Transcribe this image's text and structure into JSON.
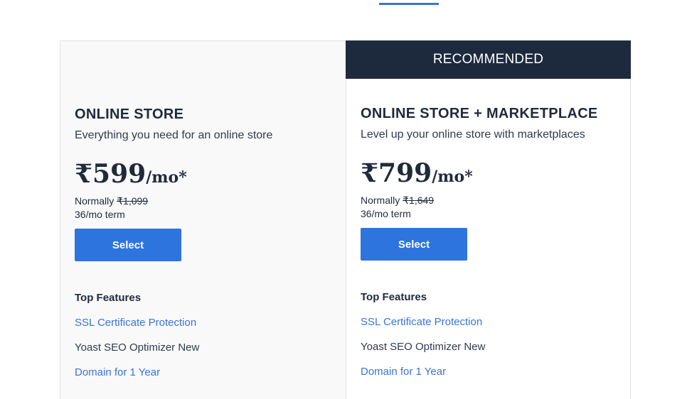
{
  "plans": [
    {
      "name": "ONLINE STORE",
      "description": "Everything you need for an online store",
      "price": "₹599",
      "per": "/mo*",
      "normally_label": "Normally",
      "normally_price": "₹1,099",
      "term": "36/mo term",
      "select_label": "Select",
      "features_title": "Top Features",
      "features": [
        "SSL Certificate Protection",
        "Yoast SEO Optimizer New",
        "Domain for 1 Year"
      ]
    },
    {
      "badge": "RECOMMENDED",
      "name": "ONLINE STORE + MARKETPLACE",
      "description": "Level up your online store with marketplaces",
      "price": "₹799",
      "per": "/mo*",
      "normally_label": "Normally",
      "normally_price": "₹1,649",
      "term": "36/mo term",
      "select_label": "Select",
      "features_title": "Top Features",
      "features": [
        "SSL Certificate Protection",
        "Yoast SEO Optimizer New",
        "Domain for 1 Year"
      ]
    }
  ],
  "colors": {
    "accent": "#2e74de",
    "link": "#3a74d1",
    "banner": "#1d2a3e"
  }
}
